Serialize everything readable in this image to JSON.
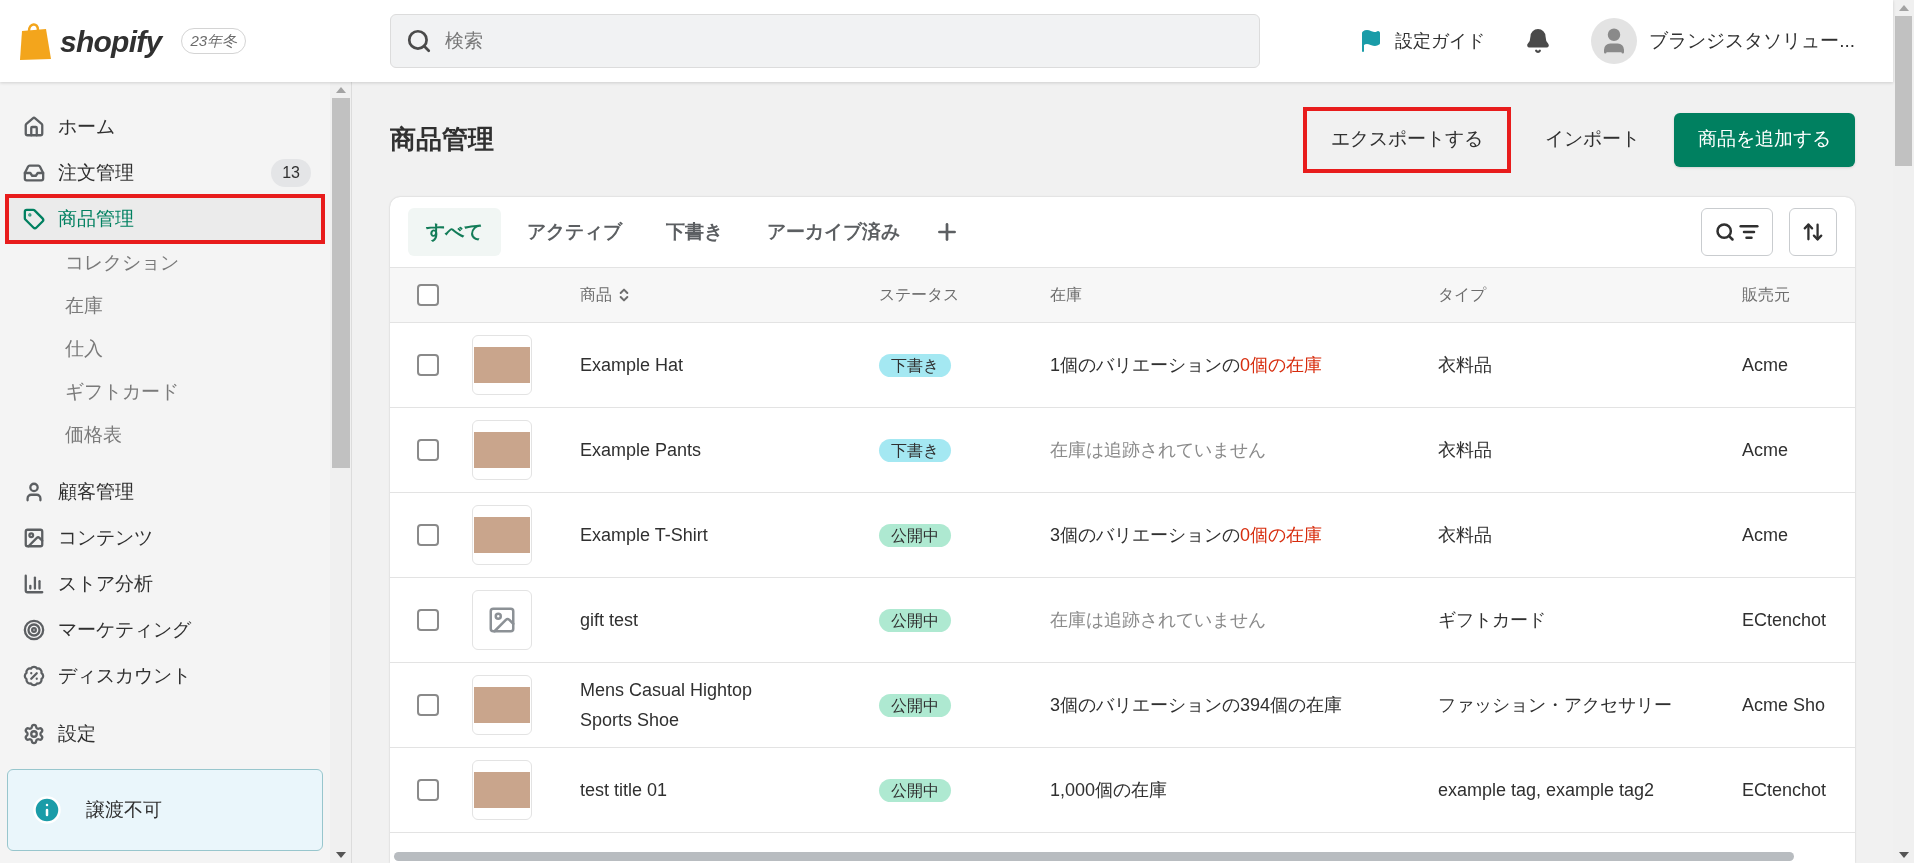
{
  "header": {
    "brand": "shopify",
    "edition": "23年冬",
    "search": {
      "placeholder": "検索"
    },
    "setup_guide": "設定ガイド",
    "account_name": "ブランジスタソリュー..."
  },
  "sidebar": {
    "items": [
      {
        "label": "ホーム",
        "selected": false,
        "highlighted": false
      },
      {
        "label": "注文管理",
        "selected": false,
        "highlighted": false,
        "badge": "13"
      },
      {
        "label": "商品管理",
        "selected": true,
        "highlighted": true,
        "children": [
          {
            "label": "コレクション"
          },
          {
            "label": "在庫"
          },
          {
            "label": "仕入"
          },
          {
            "label": "ギフトカード"
          },
          {
            "label": "価格表"
          }
        ]
      },
      {
        "label": "顧客管理",
        "selected": false,
        "highlighted": false
      },
      {
        "label": "コンテンツ",
        "selected": false,
        "highlighted": false
      },
      {
        "label": "ストア分析",
        "selected": false,
        "highlighted": false
      },
      {
        "label": "マーケティング",
        "selected": false,
        "highlighted": false
      },
      {
        "label": "ディスカウント",
        "selected": false,
        "highlighted": false
      },
      {
        "label": "設定",
        "selected": false,
        "highlighted": false
      }
    ],
    "notice": "譲渡不可"
  },
  "page": {
    "title": "商品管理",
    "actions": [
      {
        "label": "エクスポートする",
        "kind": "plain",
        "highlighted": true
      },
      {
        "label": "インポート",
        "kind": "plain",
        "highlighted": false
      },
      {
        "label": "商品を追加する",
        "kind": "primary",
        "highlighted": false
      }
    ]
  },
  "tabs": [
    {
      "label": "すべて",
      "selected": true
    },
    {
      "label": "アクティブ",
      "selected": false
    },
    {
      "label": "下書き",
      "selected": false
    },
    {
      "label": "アーカイブ済み",
      "selected": false
    }
  ],
  "table": {
    "all_checked": false,
    "columns": [
      "商品",
      "ステータス",
      "在庫",
      "タイプ",
      "販売元"
    ],
    "rows": [
      {
        "checked": false,
        "kind": "photo",
        "name": "Example Hat",
        "status": {
          "label": "下書き",
          "kind": "draft"
        },
        "inventory": [
          {
            "text": "1個のバリエーションの",
            "kind": "plain"
          },
          {
            "text": "0個の在庫",
            "kind": "alert"
          }
        ],
        "type": "衣料品",
        "vendor": "Acme"
      },
      {
        "checked": false,
        "kind": "photo",
        "name": "Example Pants",
        "status": {
          "label": "下書き",
          "kind": "draft"
        },
        "inventory": [
          {
            "text": "在庫は追跡されていません",
            "kind": "muted"
          }
        ],
        "type": "衣料品",
        "vendor": "Acme"
      },
      {
        "checked": false,
        "kind": "photo",
        "name": "Example T-Shirt",
        "status": {
          "label": "公開中",
          "kind": "active"
        },
        "inventory": [
          {
            "text": "3個のバリエーションの",
            "kind": "plain"
          },
          {
            "text": "0個の在庫",
            "kind": "alert"
          }
        ],
        "type": "衣料品",
        "vendor": "Acme"
      },
      {
        "checked": false,
        "kind": "placeholder",
        "name": "gift test",
        "status": {
          "label": "公開中",
          "kind": "active"
        },
        "inventory": [
          {
            "text": "在庫は追跡されていません",
            "kind": "muted"
          }
        ],
        "type": "ギフトカード",
        "vendor": "ECtenchot"
      },
      {
        "checked": false,
        "kind": "photo",
        "name": "Mens Casual Hightop Sports Shoe",
        "status": {
          "label": "公開中",
          "kind": "active"
        },
        "inventory": [
          {
            "text": "3個のバリエーションの394個の在庫",
            "kind": "plain"
          }
        ],
        "type": "ファッション・アクセサリー",
        "vendor": "Acme Sho"
      },
      {
        "checked": false,
        "kind": "photo",
        "name": "test title 01",
        "status": {
          "label": "公開中",
          "kind": "active"
        },
        "inventory": [
          {
            "text": "1,000個の在庫",
            "kind": "plain"
          }
        ],
        "type": "example tag, example tag2",
        "vendor": "ECtenchot"
      }
    ]
  }
}
